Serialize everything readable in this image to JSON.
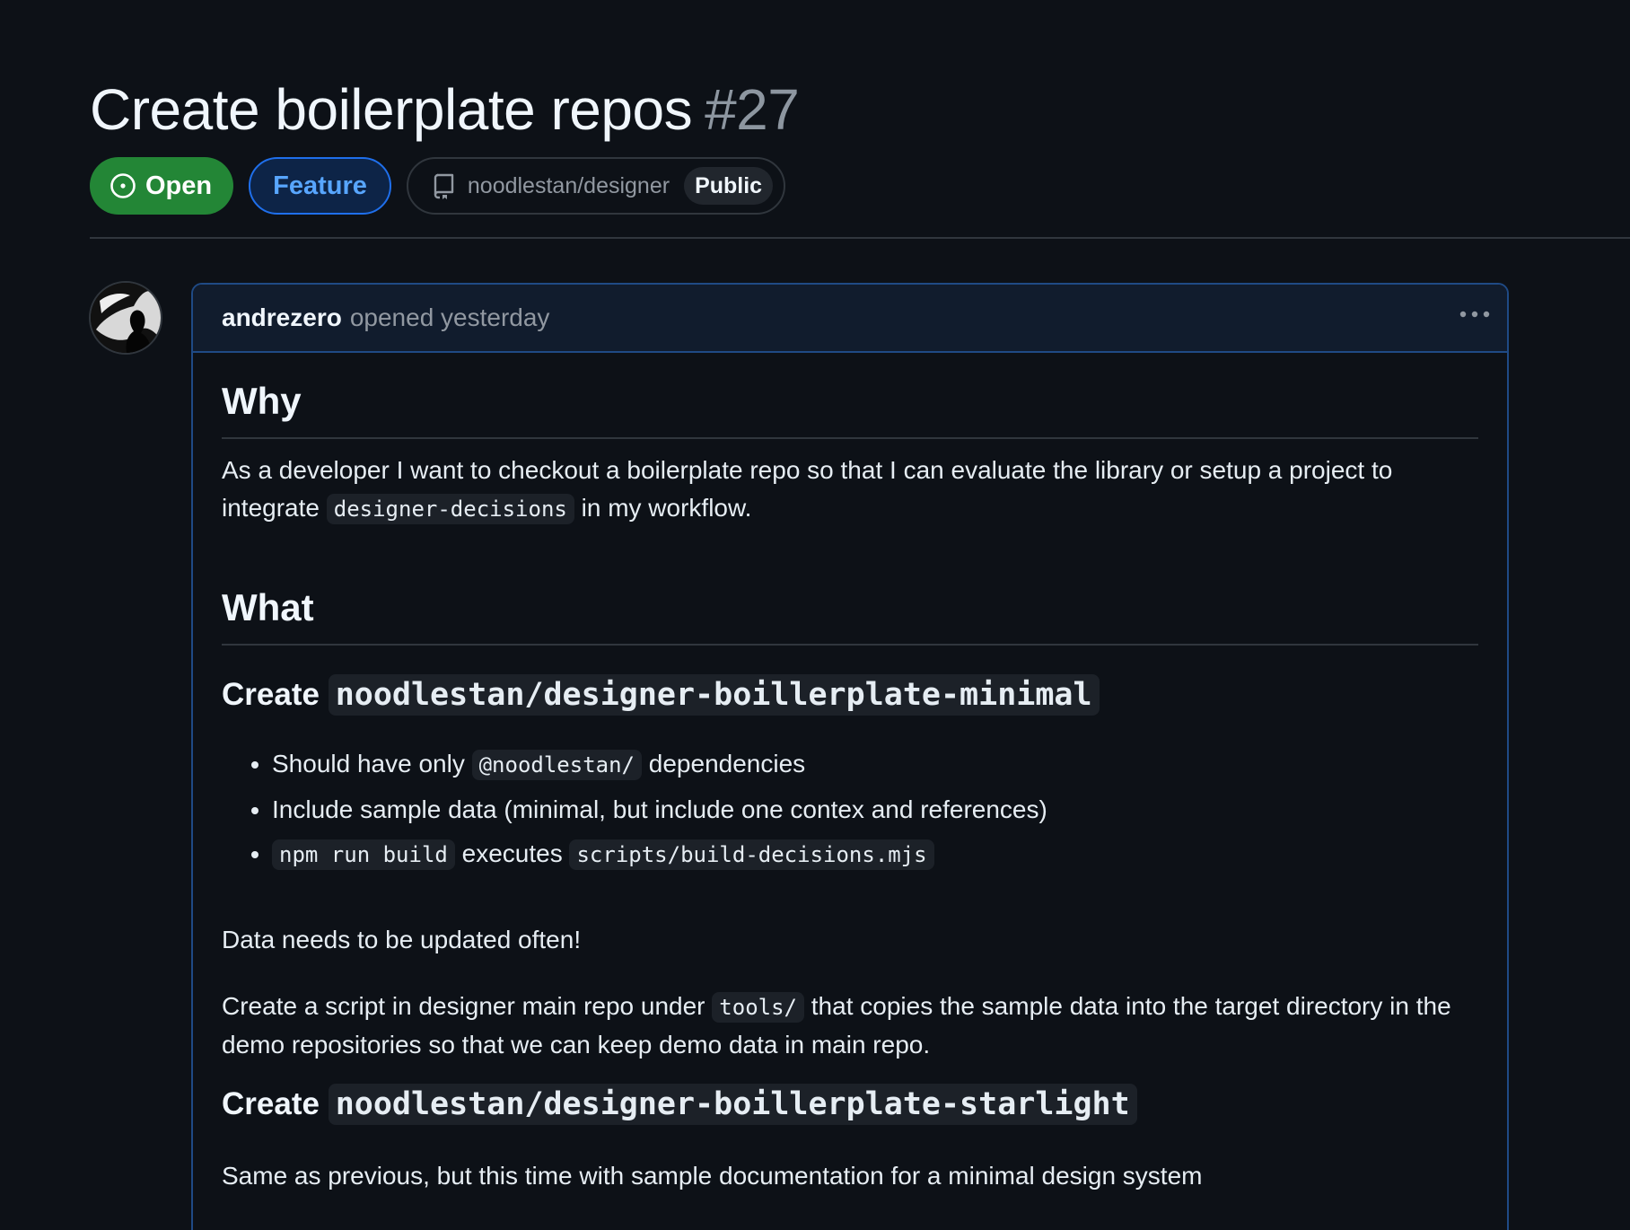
{
  "issue": {
    "title": "Create boilerplate repos",
    "number": "#27",
    "state": "Open",
    "label": "Feature",
    "repo": "noodlestan/designer",
    "visibility": "Public"
  },
  "comment": {
    "author": "andrezero",
    "action_time": "opened yesterday",
    "sections": {
      "why_heading": "Why",
      "why_text_1": "As a developer I want to checkout a boilerplate repo so that I can evaluate the library or setup a project to integrate",
      "why_code": "designer-decisions",
      "why_text_2": "in my workflow.",
      "what_heading": "What",
      "minimal_heading_prefix": "Create",
      "minimal_heading_code": "noodlestan/designer-boillerplate-minimal",
      "bullets": {
        "b1_text_1": "Should have only",
        "b1_code": "@noodlestan/",
        "b1_text_2": "dependencies",
        "b2_text": "Include sample data (minimal, but include one contex and references)",
        "b3_code_1": "npm run build",
        "b3_text": "executes",
        "b3_code_2": "scripts/build-decisions.mjs"
      },
      "data_note": "Data needs to be updated often!",
      "script_text_1": "Create a script in designer main repo under",
      "script_code": "tools/",
      "script_text_2": "that copies the sample data into the target directory in the demo repositories so that we can keep demo data in main repo.",
      "starlight_heading_prefix": "Create",
      "starlight_heading_code": "noodlestan/designer-boillerplate-starlight",
      "starlight_text": "Same as previous, but this time with sample documentation for a minimal design system"
    }
  },
  "colors": {
    "background": "#0d1117",
    "open_green": "#238636",
    "label_blue": "#58a6ff",
    "comment_border": "#1f4a85"
  }
}
